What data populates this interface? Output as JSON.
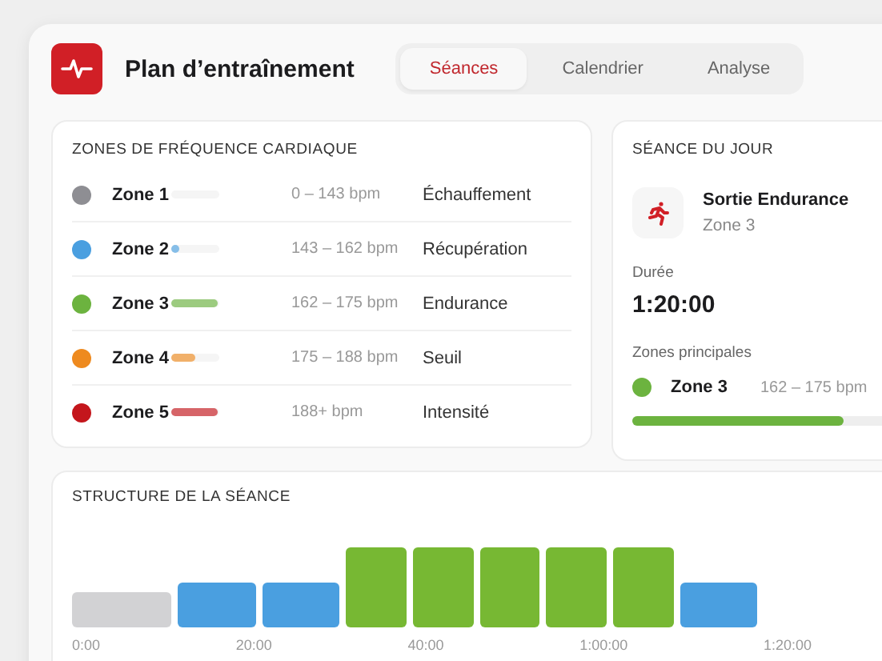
{
  "header": {
    "title": "Plan d’entraînement"
  },
  "tabs": [
    {
      "label": "Séances",
      "selected": true
    },
    {
      "label": "Calendrier",
      "selected": false
    },
    {
      "label": "Analyse",
      "selected": false
    }
  ],
  "zones": {
    "title": "ZONES DE FRÉQUENCE CARDIAQUE",
    "items": [
      {
        "name": "Zone 1",
        "color": "#8e8e93",
        "level": 0,
        "range": "0 – 143 bpm",
        "label": "Échauffement"
      },
      {
        "name": "Zone 2",
        "color": "#4a9fe0",
        "level": 0.15,
        "range": "143 – 162 bpm",
        "label": "Récupération"
      },
      {
        "name": "Zone 3",
        "color": "#6cb33f",
        "level": 0.95,
        "range": "162 – 175 bpm",
        "label": "Endurance"
      },
      {
        "name": "Zone 4",
        "color": "#ee8a1f",
        "level": 0.5,
        "range": "175 – 188 bpm",
        "label": "Seuil"
      },
      {
        "name": "Zone 5",
        "color": "#c4161c",
        "level": 0.95,
        "range": "188+ bpm",
        "label": "Intensité"
      }
    ]
  },
  "session": {
    "title": "SÉANCE DU JOUR",
    "name": "Sortie Endurance",
    "zone": "Zone 3",
    "duration_label": "Durée",
    "duration": "1:20:00",
    "zones_label": "Zones principales",
    "main_zone": {
      "name": "Zone 3",
      "color": "#6cb33f",
      "range": "162 – 175 bpm",
      "level": 0.72
    }
  },
  "structure": {
    "title": "STRUCTURE DE LA SÉANCE",
    "segments": [
      {
        "kind": "zone1"
      },
      {
        "kind": "zone2"
      },
      {
        "kind": "zone2"
      },
      {
        "kind": "zone3"
      },
      {
        "kind": "zone3"
      },
      {
        "kind": "zone3"
      },
      {
        "kind": "zone3"
      },
      {
        "kind": "zone3"
      },
      {
        "kind": "zone2"
      }
    ],
    "ticks": [
      "0:00",
      "20:00",
      "40:00",
      "1:00:00",
      "1:20:00"
    ]
  }
}
